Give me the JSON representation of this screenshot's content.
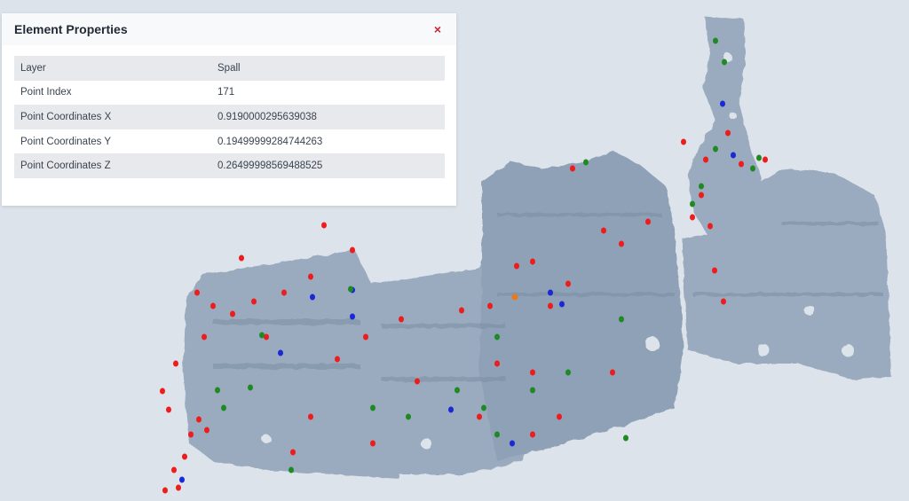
{
  "panel": {
    "title": "Element Properties",
    "close_label": "×",
    "properties": [
      {
        "label": "Layer",
        "value": "Spall"
      },
      {
        "label": "Point Index",
        "value": "171"
      },
      {
        "label": "Point Coordinates X",
        "value": "0.9190000295639038"
      },
      {
        "label": "Point Coordinates Y",
        "value": "0.19499999284744263"
      },
      {
        "label": "Point Coordinates Z",
        "value": "0.26499998569488525"
      }
    ]
  },
  "viewer": {
    "model_color": "#9aabbf",
    "marker_colors": {
      "red": "#ee1c1c",
      "green": "#1f8a22",
      "blue": "#1a28d6"
    }
  }
}
